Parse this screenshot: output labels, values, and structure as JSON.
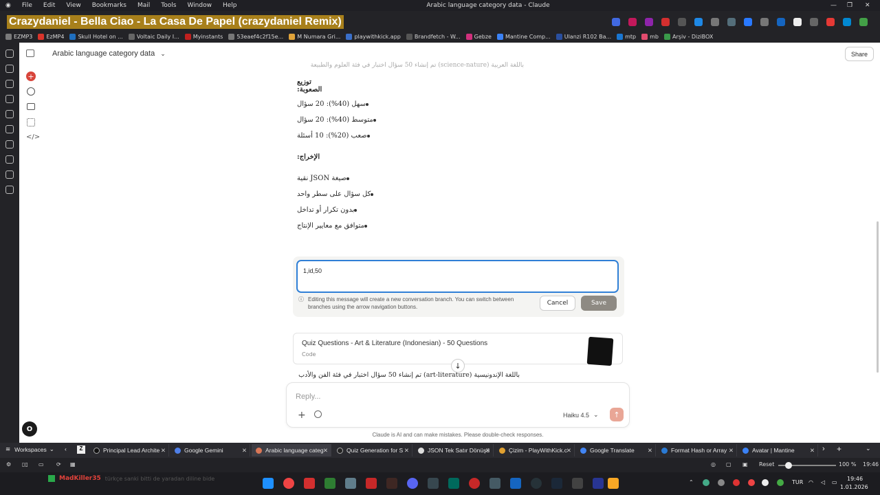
{
  "menubar": {
    "items": [
      "File",
      "Edit",
      "View",
      "Bookmarks",
      "Mail",
      "Tools",
      "Window",
      "Help"
    ],
    "title": "Arabic language category data - Claude"
  },
  "now_playing": "Crazydaniel - Bella Ciao - La Casa De Papel (crazydaniel Remix)",
  "bookmarks": [
    {
      "label": "EZMP3",
      "color": "#7a7a7a"
    },
    {
      "label": "EzMP4",
      "color": "#d9342b"
    },
    {
      "label": "Skull Hotel on ...",
      "color": "#1f6fbf"
    },
    {
      "label": "Voltaic Daily I...",
      "color": "#666666"
    },
    {
      "label": "Myinstants",
      "color": "#c0201e"
    },
    {
      "label": "53eaef4c2f15e...",
      "color": "#777777"
    },
    {
      "label": "M Numara Gri...",
      "color": "#e0a33a"
    },
    {
      "label": "playwithkick.app",
      "color": "#3a6fc9"
    },
    {
      "label": "Brandfetch - W...",
      "color": "#555555"
    },
    {
      "label": "Gebze",
      "color": "#d1307c"
    },
    {
      "label": "Mantine Comp...",
      "color": "#3b82f6"
    },
    {
      "label": "Ulanzi R102 Ba...",
      "color": "#2a4f9f"
    },
    {
      "label": "mtp",
      "color": "#1976d2"
    },
    {
      "label": "mb",
      "color": "#e14b6e"
    },
    {
      "label": "Arşiv - DiziBOX",
      "color": "#3a9a4a"
    }
  ],
  "conversation": {
    "title": "Arabic language category data",
    "share": "Share",
    "top_partial": "باللغة العربية (science-nature) تم إنشاء 50 سؤال اختبار في فئة العلوم والطبيعة",
    "difficulty_heading": "توزيع الصعوبة:",
    "difficulty_items": [
      "سهل (40%): 20 سؤال",
      "متوسط (40%): 20 سؤال",
      "صعب (20%): 10 أسئلة"
    ],
    "output_heading": "الإخراج:",
    "output_items": [
      "صيغة JSON نقية",
      "كل سؤال على سطر واحد",
      "بدون تكرار أو تداخل",
      "متوافق مع معايير الإنتاج"
    ]
  },
  "edit": {
    "value": "1,id,50",
    "info": "Editing this message will create a new conversation branch. You can switch between branches using the arrow navigation buttons.",
    "cancel": "Cancel",
    "save": "Save"
  },
  "artifact": {
    "title": "Quiz Questions - Art & Literature (Indonesian) - 50 Questions",
    "type": "Code"
  },
  "art_line": "باللغة الإندونيسية (art-literature) تم إنشاء 50 سؤال اختبار في فئة الفن والأدب",
  "composer": {
    "placeholder": "Reply...",
    "model": "Haiku 4.5",
    "disclaimer": "Claude is AI and can make mistakes. Please double-check responses."
  },
  "workspace_tabs": [
    {
      "label": "Principal Lead Archite",
      "color": "#111111"
    },
    {
      "label": "Google Gemini",
      "color": "#4f7fe8"
    },
    {
      "label": "Arabic language categ",
      "color": "#d97757",
      "active": true
    },
    {
      "label": "Quiz Generation for S",
      "color": "#222222"
    },
    {
      "label": "JSON Tek Satır Dönüşü",
      "color": "#dddddd"
    },
    {
      "label": "Çizim - PlayWithKick.c",
      "color": "#e0a030"
    },
    {
      "label": "Google Translate",
      "color": "#4285f4"
    },
    {
      "label": "Format Hash or Array",
      "color": "#2a7ad4"
    },
    {
      "label": "Avatar | Mantine",
      "color": "#3b82f6"
    }
  ],
  "workspaces_label": "Workspaces",
  "statusbar": {
    "reset": "Reset",
    "zoom": "100 %",
    "time": "19:46"
  },
  "taskbar": {
    "user": "MadKiller35",
    "status_text": "türkçe sanki bitti de yaradan diline bide",
    "lang": "TUR",
    "clock_time": "19:46",
    "clock_date": "1.01.2026"
  }
}
